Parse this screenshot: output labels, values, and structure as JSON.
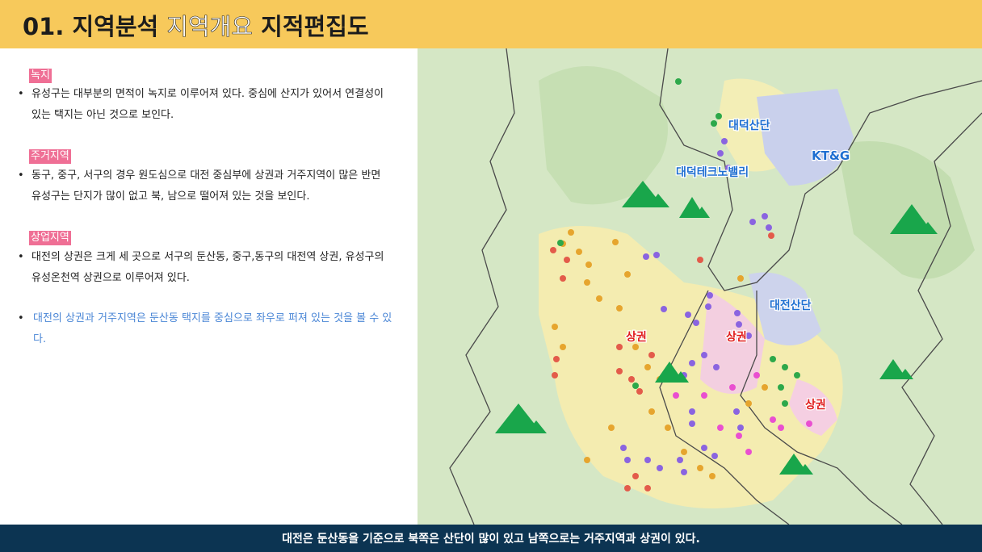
{
  "header": {
    "title_prefix": "01. 지역분석",
    "title_light": "지역개요",
    "title_suffix": "지적편집도"
  },
  "sections": [
    {
      "tag": "녹지",
      "text": "유성구는 대부분의 면적이 녹지로 이루어져 있다. 중심에 산지가 있어서 연결성이 있는 택지는 아닌 것으로 보인다."
    },
    {
      "tag": "주거지역",
      "text": "동구, 중구, 서구의 경우 원도심으로 대전 중심부에 상권과 거주지역이 많은 반면 유성구는 단지가 많이 없고 북, 남으로 떨어져 있는 것을 보인다."
    },
    {
      "tag": "상업지역",
      "text": "대전의 상권은 크게 세 곳으로 서구의 둔산동, 중구,동구의 대전역 상권, 유성구의 유성온천역 상권으로 이루어져 있다."
    }
  ],
  "highlight": {
    "text": "대전의 상권과 거주지역은 둔산동 택지를 중심으로 좌우로 퍼져 있는 것을 볼 수 있다."
  },
  "map": {
    "industrial_labels": [
      "대덕산단",
      "KT&G",
      "대덕테크노밸리",
      "대전산단"
    ],
    "commercial_labels": [
      "상권",
      "상권",
      "상권"
    ],
    "colors": {
      "industrial": "#1f6fd1",
      "commercial": "#e01b1b",
      "mountain": "#1aa64b"
    }
  },
  "footer": {
    "text": "대전은 둔산동을 기준으로 북쪽은 산단이 많이 있고 남쪽으로는 거주지역과 상권이 있다."
  }
}
